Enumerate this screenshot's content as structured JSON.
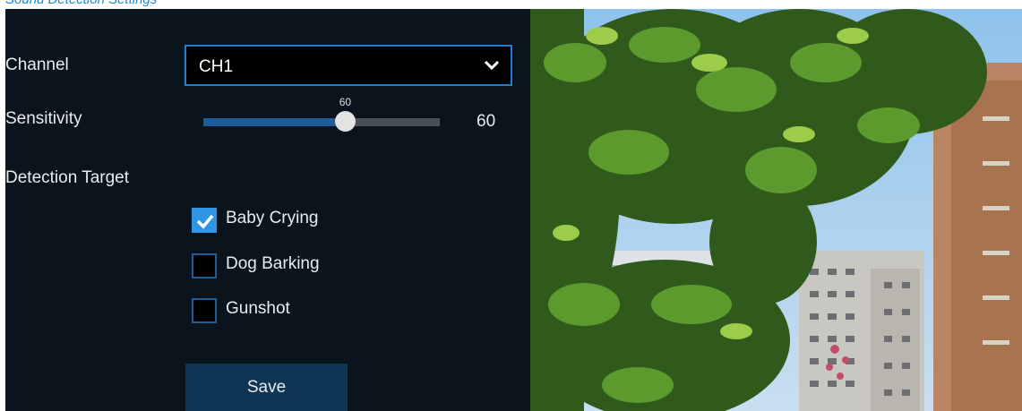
{
  "header": {
    "crumb": "Sound Detection Settings"
  },
  "form": {
    "channel": {
      "label": "Channel",
      "value": "CH1"
    },
    "sensitivity": {
      "label": "Sensitivity",
      "value": 60,
      "value_text": "60",
      "tooltip": "60",
      "min": 0,
      "max": 100
    },
    "detection_target": {
      "label": "Detection Target",
      "options": [
        {
          "label": "Baby Crying",
          "checked": true
        },
        {
          "label": "Dog Barking",
          "checked": false
        },
        {
          "label": "Gunshot",
          "checked": false
        }
      ]
    },
    "save_label": "Save"
  },
  "colors": {
    "accent": "#2f96e6",
    "panel_bg": "#0b131c",
    "button_bg": "#0f3554",
    "select_border": "#1e7fd0"
  },
  "icons": {
    "dropdown": "chevron-down-icon",
    "checkbox": "checkmark-icon"
  }
}
